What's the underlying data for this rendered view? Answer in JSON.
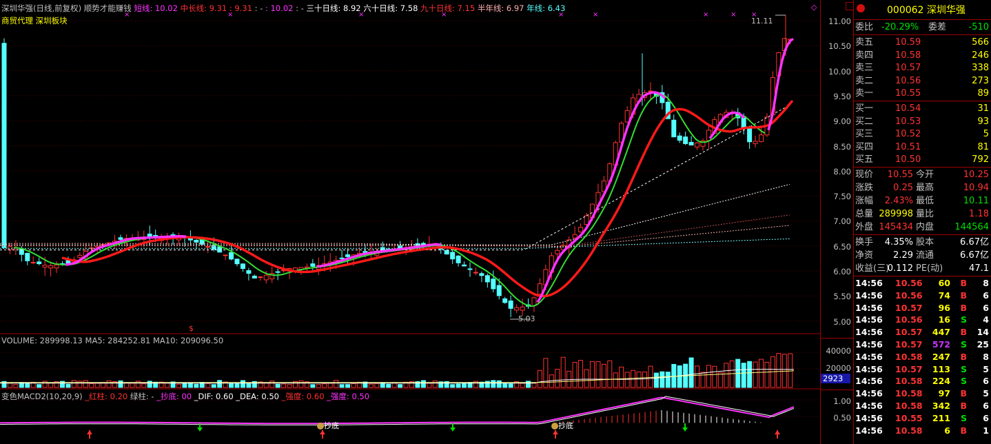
{
  "header": {
    "title": "深圳华强(日线,前复权)",
    "subtitle": "顺势才能赚钱",
    "ma_short_label": "短线: ",
    "ma_short_val": "10.02",
    "ma_mid_label": "中长线: ",
    "ma_mid_val": "9.31",
    "ma_sep1": " : 9.31",
    "ma_sep2": " : - ",
    "ma_sep3": " : 10.02",
    "ma_sep4": " : - ",
    "ma30_label": "三十日线: ",
    "ma30_val": "8.92",
    "ma60_label": "六十日线: ",
    "ma60_val": "7.58",
    "ma90_label": "九十日线: ",
    "ma90_val": "7.15",
    "ma120_label": "半年线: ",
    "ma120_val": "6.97",
    "ma250_label": "年线: ",
    "ma250_val": "6.43",
    "tags": "商贸代理  深圳板块"
  },
  "price_axis": [
    "11.00",
    "10.50",
    "10.00",
    "9.50",
    "9.00",
    "8.50",
    "8.00",
    "7.50",
    "7.00",
    "6.50",
    "6.00",
    "5.50",
    "5.00"
  ],
  "annotations": {
    "high": "11.11",
    "low": "5.03",
    "marker": "$"
  },
  "volume": {
    "header": "VOLUME: 289998.13  MA5: 284252.81  MA10: 209096.50",
    "axis": [
      "40000",
      "20000"
    ],
    "badge": "2923"
  },
  "macd": {
    "name": "变色MACD2(10,20,9)",
    "red_label": "_红柱: 0.20",
    "green_label": "绿柱: -",
    "bottom_label": "_抄底: 00",
    "dif_label": "_DIF: 0.60",
    "dea_label": "_DEA: 0.50",
    "strong_label": "_强度: 0.60",
    "strength_label": "_强度: 0.50",
    "axis": [
      "1.00",
      "0.50"
    ],
    "signal1": "抄底",
    "signal2": "抄底"
  },
  "quote": {
    "code": "000062",
    "name": "深圳华强",
    "wb_label": "委比",
    "wb_val": "-20.29%",
    "wc_label": "委差",
    "wc_val": "-510",
    "asks": [
      {
        "label": "卖五",
        "price": "10.59",
        "vol": "566"
      },
      {
        "label": "卖四",
        "price": "10.58",
        "vol": "246"
      },
      {
        "label": "卖三",
        "price": "10.57",
        "vol": "338"
      },
      {
        "label": "卖二",
        "price": "10.56",
        "vol": "273"
      },
      {
        "label": "卖一",
        "price": "10.55",
        "vol": "89"
      }
    ],
    "bids": [
      {
        "label": "买一",
        "price": "10.54",
        "vol": "31"
      },
      {
        "label": "买二",
        "price": "10.53",
        "vol": "93"
      },
      {
        "label": "买三",
        "price": "10.52",
        "vol": "5"
      },
      {
        "label": "买四",
        "price": "10.51",
        "vol": "81"
      },
      {
        "label": "买五",
        "price": "10.50",
        "vol": "792"
      }
    ],
    "stats1": [
      {
        "l1": "现价",
        "v1": "10.55",
        "l2": "今开",
        "v2": "10.25"
      },
      {
        "l1": "涨跌",
        "v1": "0.25",
        "l2": "最高",
        "v2": "10.94"
      },
      {
        "l1": "涨幅",
        "v1": "2.43%",
        "l2": "最低",
        "v2": "10.11"
      },
      {
        "l1": "总量",
        "v1": "289998",
        "l2": "量比",
        "v2": "1.18"
      },
      {
        "l1": "外盘",
        "v1": "145434",
        "l2": "内盘",
        "v2": "144564"
      }
    ],
    "stats2": [
      {
        "l1": "换手",
        "v1": "4.35%",
        "l2": "股本",
        "v2": "6.67亿"
      },
      {
        "l1": "净资",
        "v1": "2.29",
        "l2": "流通",
        "v2": "6.67亿"
      },
      {
        "l1": "收益(三)",
        "v1": "0.112",
        "l2": "PE(动)",
        "v2": "47.1"
      }
    ],
    "ticks": [
      {
        "t": "14:56",
        "p": "10.56",
        "v": "60",
        "s": "B",
        "n": "8"
      },
      {
        "t": "14:56",
        "p": "10.56",
        "v": "74",
        "s": "B",
        "n": "6"
      },
      {
        "t": "14:56",
        "p": "10.57",
        "v": "96",
        "s": "B",
        "n": "6"
      },
      {
        "t": "14:56",
        "p": "10.56",
        "v": "16",
        "s": "S",
        "n": "4"
      },
      {
        "t": "14:56",
        "p": "10.57",
        "v": "447",
        "s": "B",
        "n": "14"
      },
      {
        "t": "14:56",
        "p": "10.57",
        "v": "572",
        "s": "S",
        "n": "25"
      },
      {
        "t": "14:56",
        "p": "10.58",
        "v": "247",
        "s": "B",
        "n": "8"
      },
      {
        "t": "14:56",
        "p": "10.57",
        "v": "113",
        "s": "S",
        "n": "5"
      },
      {
        "t": "14:56",
        "p": "10.58",
        "v": "224",
        "s": "S",
        "n": "6"
      },
      {
        "t": "14:56",
        "p": "10.58",
        "v": "97",
        "s": "B",
        "n": "5"
      },
      {
        "t": "14:56",
        "p": "10.58",
        "v": "342",
        "s": "B",
        "n": "6"
      },
      {
        "t": "14:56",
        "p": "10.55",
        "v": "211",
        "s": "S",
        "n": "6"
      },
      {
        "t": "14:56",
        "p": "10.58",
        "v": "6",
        "s": "B",
        "n": "1"
      }
    ]
  },
  "colors": {
    "up": "#ff3232",
    "down": "#54ffff",
    "bg": "#000000",
    "grid": "#800000",
    "ma_short": "#ff33ff",
    "ma_mid": "#ff1a1a",
    "ma_green": "#33dd33",
    "yellow": "#ffff00"
  }
}
